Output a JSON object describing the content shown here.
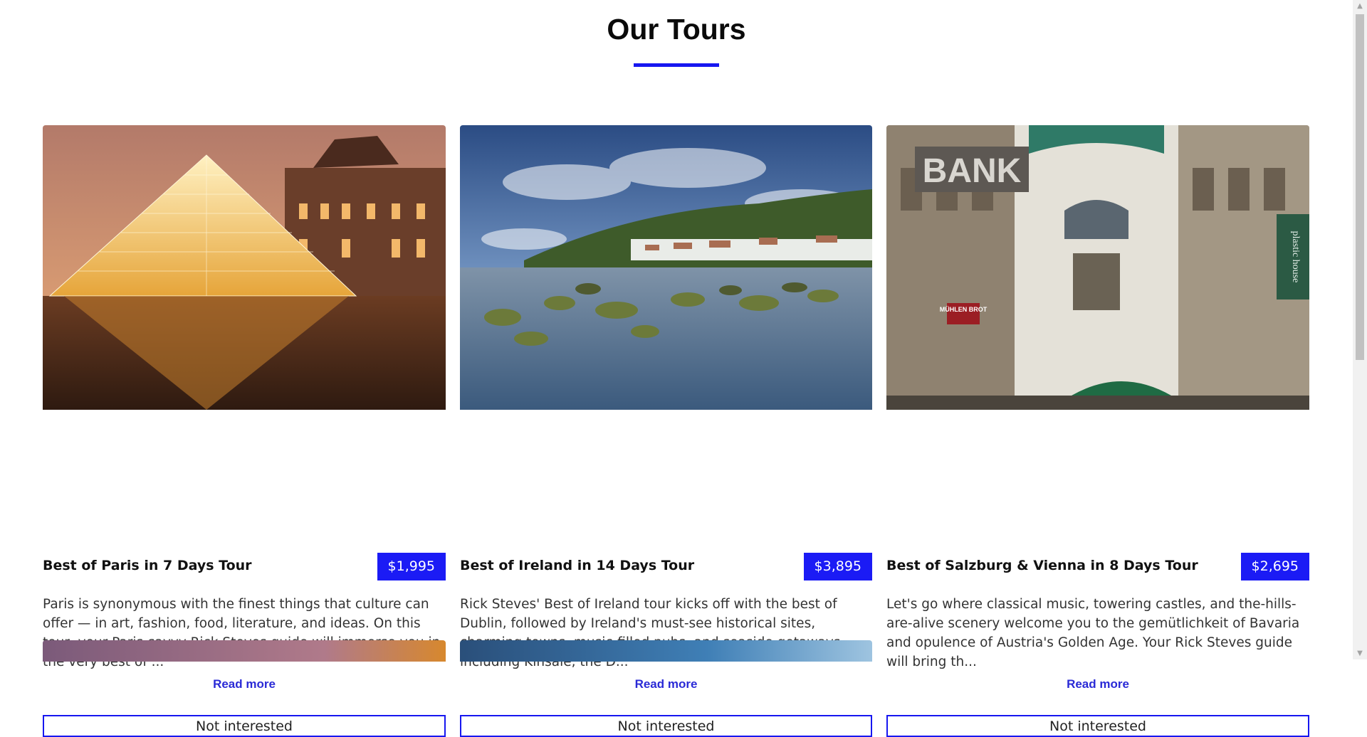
{
  "page": {
    "title": "Our Tours",
    "accent_color": "#1717f0"
  },
  "tours": [
    {
      "title": "Best of Paris in 7 Days Tour",
      "price": "$1,995",
      "description": "Paris is synonymous with the finest things that culture can offer — in art, fashion, food, literature, and ideas. On this tour, your Paris-savvy Rick Steves guide will immerse you in the very best of ...",
      "read_more": "Read more",
      "not_interested": "Not interested",
      "image_icon": "louvre-pyramid-image"
    },
    {
      "title": "Best of Ireland in 14 Days Tour",
      "price": "$3,895",
      "description": "Rick Steves' Best of Ireland tour kicks off with the best of Dublin, followed by Ireland's must-see historical sites, charming towns, music-filled pubs, and seaside getaways — including Kinsale, the D...",
      "read_more": "Read more",
      "not_interested": "Not interested",
      "image_icon": "ireland-coast-image"
    },
    {
      "title": "Best of Salzburg & Vienna in 8 Days Tour",
      "price": "$2,695",
      "description": "Let's go where classical music, towering castles, and the-hills-are-alive scenery welcome you to the gemütlichkeit of Bavaria and opulence of Austria's Golden Age. Your Rick Steves guide will bring th...",
      "read_more": "Read more",
      "not_interested": "Not interested",
      "image_icon": "vienna-street-image",
      "image_texts": {
        "bank_sign": "BANK",
        "shop_sign": "MÜHLEN BROT",
        "side_sign": "plastic house"
      }
    }
  ]
}
